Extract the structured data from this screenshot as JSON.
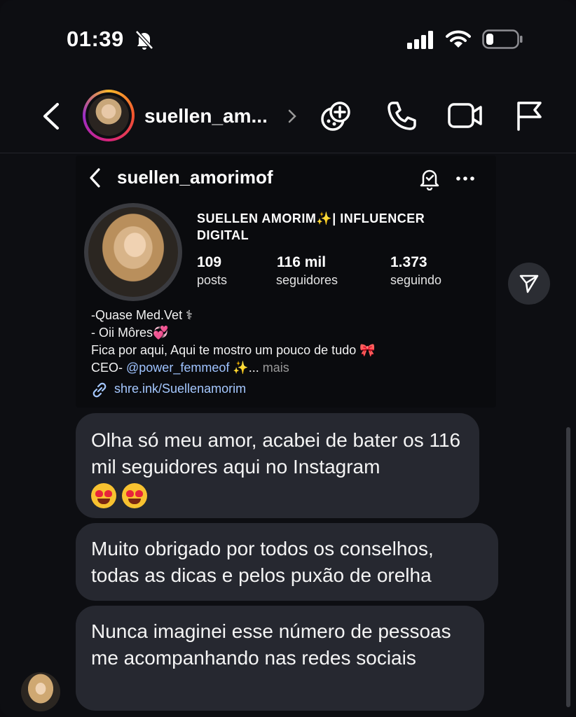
{
  "status_bar": {
    "time": "01:39"
  },
  "header": {
    "username": "suellen_am..."
  },
  "profile_card": {
    "username": "suellen_amorimof",
    "display_name": "SUELLEN AMORIM✨|  INFLUENCER DIGITAL",
    "stats": [
      {
        "value": "109",
        "label": "posts"
      },
      {
        "value": "116 mil",
        "label": "seguidores"
      },
      {
        "value": "1.373",
        "label": "seguindo"
      }
    ],
    "bio": {
      "line1": "-Quase Med.Vet ⚕",
      "line2": "- Oii Môres💞",
      "line3": "Fica por aqui, Aqui te mostro um pouco de tudo 🎀",
      "line4_prefix": "CEO- ",
      "line4_handle": "@power_femmeof",
      "line4_suffix": " ✨...",
      "more": "mais"
    },
    "link": "shre.ink/Suellenamorim"
  },
  "messages": [
    {
      "text": "Olha só meu amor, acabei de bater os 116 mil seguidores aqui no Instagram"
    },
    {
      "text": "Muito obrigado por todos os conselhos, todas as dicas e pelos puxão de orelha"
    },
    {
      "text": "Nunca imaginei esse número de pessoas me acompanhando nas redes sociais"
    }
  ],
  "icons": {
    "status": [
      "bell-slash-icon",
      "signal-icon",
      "wifi-icon",
      "battery-icon"
    ],
    "header": [
      "back-icon",
      "games-icon",
      "phone-icon",
      "video-icon",
      "flag-icon"
    ],
    "card": [
      "back-icon",
      "bell-icon",
      "more-icon",
      "link-icon"
    ],
    "share": "send-icon"
  },
  "colors": {
    "background": "#0d0e12",
    "bubble": "#262830",
    "link": "#a5c8ff"
  }
}
